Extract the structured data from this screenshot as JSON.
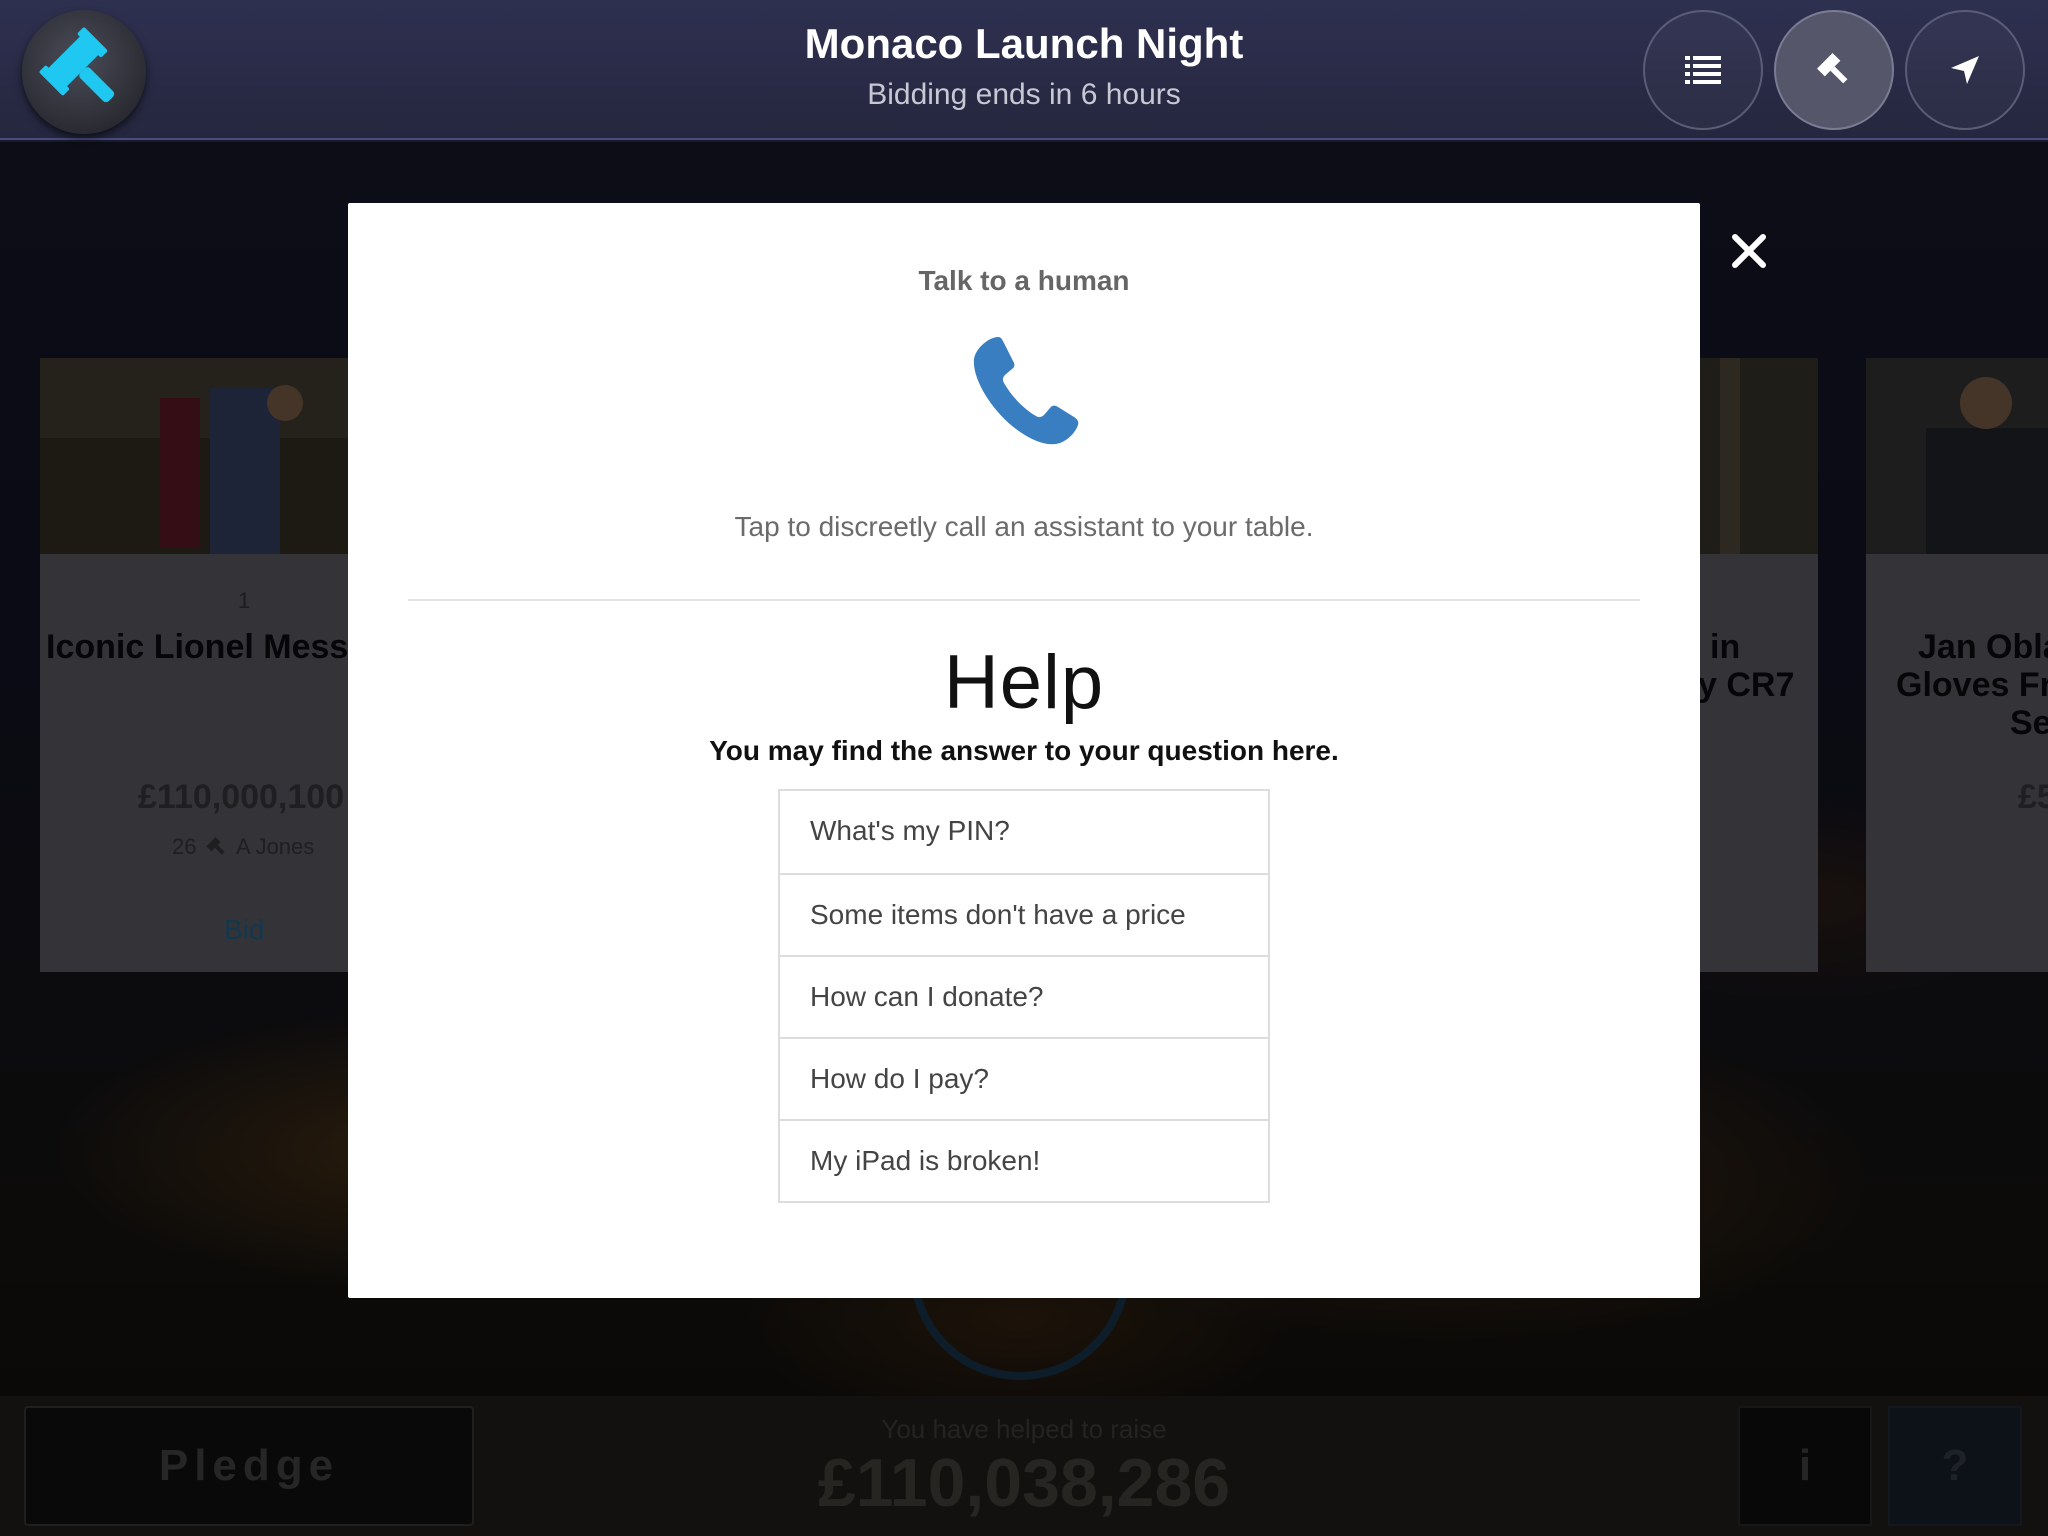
{
  "header": {
    "title": "Monaco Launch Night",
    "subtitle": "Bidding ends in 6 hours",
    "nav": [
      {
        "icon": "list-icon"
      },
      {
        "icon": "gavel-icon"
      },
      {
        "icon": "location-arrow-icon"
      }
    ]
  },
  "cards": [
    {
      "number": "1",
      "title": "Iconic Lionel Mess",
      "price": "£110,000,100",
      "bids": "26",
      "bidder": "A Jones",
      "action": "Bid"
    },
    {
      "title_line1": "in",
      "title_line2": "y CR7"
    },
    {
      "title_line1": "Jan Obla",
      "title_line2": "Gloves Fr",
      "title_line3": "Se",
      "price": "£5"
    }
  ],
  "bottom": {
    "pledge_label": "Pledge",
    "raise_label": "You have helped to raise",
    "raise_amount": "£110,038,286",
    "info_label": "i",
    "help_label": "?"
  },
  "modal": {
    "talk_title": "Talk to a human",
    "talk_description": "Tap to discreetly call an assistant to your table.",
    "help_title": "Help",
    "help_subtitle": "You may find the answer to your question here.",
    "faq": [
      "What's my PIN?",
      "Some items don't have a price",
      "How can I donate?",
      "How do I pay?",
      "My iPad is broken!"
    ]
  },
  "colors": {
    "accent_cyan": "#1ec8f0",
    "phone_blue": "#3a7ec2",
    "header_bg": "#2e3050"
  }
}
